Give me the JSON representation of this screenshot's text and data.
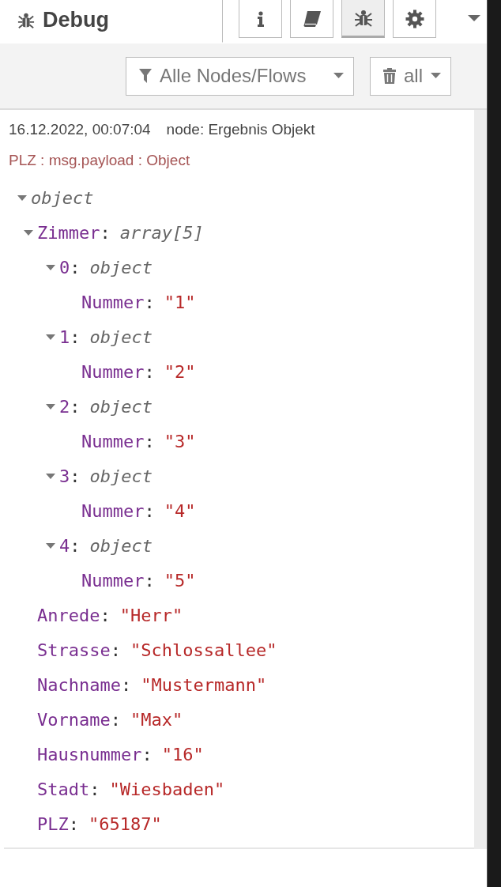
{
  "header": {
    "title": "Debug"
  },
  "tabs": [
    {
      "kind": "info",
      "selected": false
    },
    {
      "kind": "book",
      "selected": false
    },
    {
      "kind": "bug",
      "selected": true
    },
    {
      "kind": "gear",
      "selected": false
    }
  ],
  "filter": {
    "label": "Alle Nodes/Flows"
  },
  "clear": {
    "label": "all"
  },
  "message": {
    "timestamp": "16.12.2022, 00:07:04",
    "node": "node: Ergebnis Objekt",
    "topic": "PLZ : msg.payload : Object",
    "tree": {
      "type": "object",
      "expanded": true,
      "children": [
        {
          "key": "Zimmer",
          "separator": ":",
          "type": "array[5]",
          "expanded": true,
          "children": [
            {
              "key": "0",
              "separator": ":",
              "type": "object",
              "expanded": true,
              "children": [
                {
                  "key": "Nummer",
                  "separator": ":",
                  "value": "\"1\""
                }
              ]
            },
            {
              "key": "1",
              "separator": ":",
              "type": "object",
              "expanded": true,
              "children": [
                {
                  "key": "Nummer",
                  "separator": ":",
                  "value": "\"2\""
                }
              ]
            },
            {
              "key": "2",
              "separator": ":",
              "type": "object",
              "expanded": true,
              "children": [
                {
                  "key": "Nummer",
                  "separator": ":",
                  "value": "\"3\""
                }
              ]
            },
            {
              "key": "3",
              "separator": ":",
              "type": "object",
              "expanded": true,
              "children": [
                {
                  "key": "Nummer",
                  "separator": ":",
                  "value": "\"4\""
                }
              ]
            },
            {
              "key": "4",
              "separator": ":",
              "type": "object",
              "expanded": true,
              "children": [
                {
                  "key": "Nummer",
                  "separator": ":",
                  "value": "\"5\""
                }
              ]
            }
          ]
        },
        {
          "key": "Anrede",
          "separator": ":",
          "value": "\"Herr\""
        },
        {
          "key": "Strasse",
          "separator": ":",
          "value": "\"Schlossallee\""
        },
        {
          "key": "Nachname",
          "separator": ":",
          "value": "\"Mustermann\""
        },
        {
          "key": "Vorname",
          "separator": ":",
          "value": "\"Max\""
        },
        {
          "key": "Hausnummer",
          "separator": ":",
          "value": "\"16\""
        },
        {
          "key": "Stadt",
          "separator": ":",
          "value": "\"Wiesbaden\""
        },
        {
          "key": "PLZ",
          "separator": ":",
          "value": "\"65187\""
        }
      ]
    }
  }
}
